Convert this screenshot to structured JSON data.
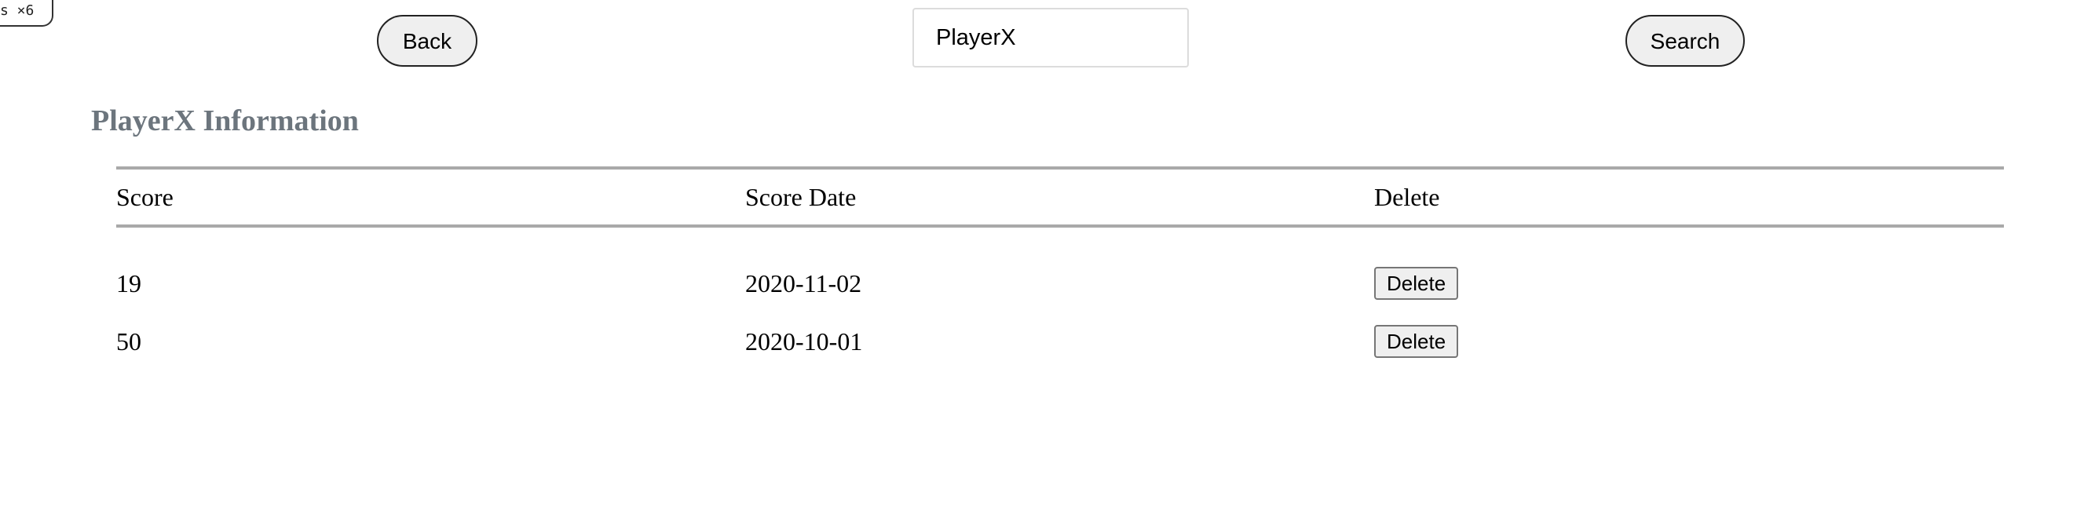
{
  "corner_tag": "s ×6",
  "toolbar": {
    "back_label": "Back",
    "search_value": "PlayerX",
    "search_label": "Search"
  },
  "page": {
    "title": "PlayerX Information"
  },
  "table": {
    "headers": [
      "Score",
      "Score Date",
      "Delete"
    ],
    "rows": [
      {
        "score": "19",
        "date": "2020-11-02",
        "delete_label": "Delete"
      },
      {
        "score": "50",
        "date": "2020-10-01",
        "delete_label": "Delete"
      }
    ]
  }
}
